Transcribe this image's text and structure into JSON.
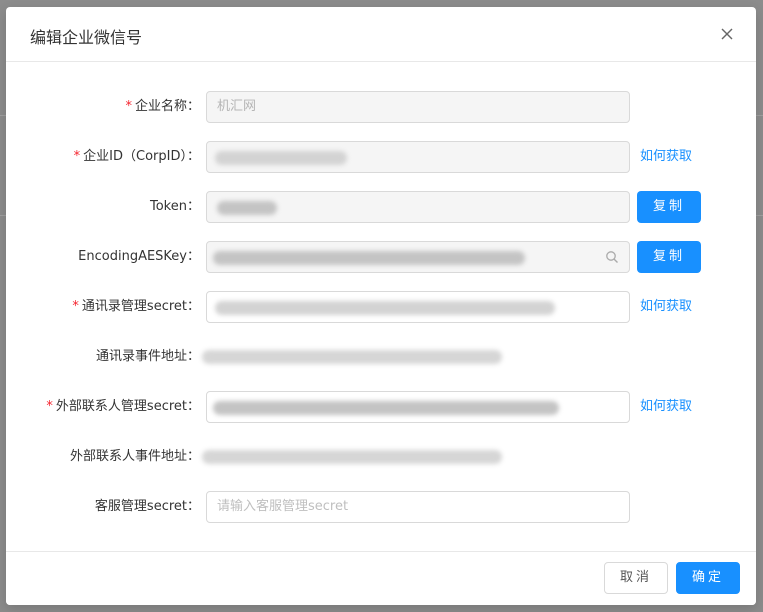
{
  "modal": {
    "title": "编辑企业微信号",
    "close_icon": "close-icon"
  },
  "form": {
    "company_name": {
      "label": "企业名称：",
      "required": true,
      "value": "机汇网"
    },
    "corp_id": {
      "label": "企业ID（CorpID）：",
      "required": true,
      "link": "如何获取"
    },
    "token": {
      "label": "Token：",
      "required": false,
      "copy_label": "复制"
    },
    "encoding_aes_key": {
      "label": "EncodingAESKey：",
      "required": false,
      "copy_label": "复制",
      "icon": "search-icon"
    },
    "contacts_secret": {
      "label": "通讯录管理secret：",
      "required": true,
      "link": "如何获取"
    },
    "contacts_event_url": {
      "label": "通讯录事件地址："
    },
    "external_contact_secret": {
      "label": "外部联系人管理secret：",
      "required": true,
      "link": "如何获取"
    },
    "external_contact_event_url": {
      "label": "外部联系人事件地址："
    },
    "customer_service_secret": {
      "label": "客服管理secret：",
      "required": false,
      "placeholder": "请输入客服管理secret"
    }
  },
  "footer": {
    "cancel_label": "取消",
    "ok_label": "确定"
  },
  "colors": {
    "primary": "#1890ff",
    "required": "#f5222d",
    "overlay": "#8c8c8c"
  }
}
